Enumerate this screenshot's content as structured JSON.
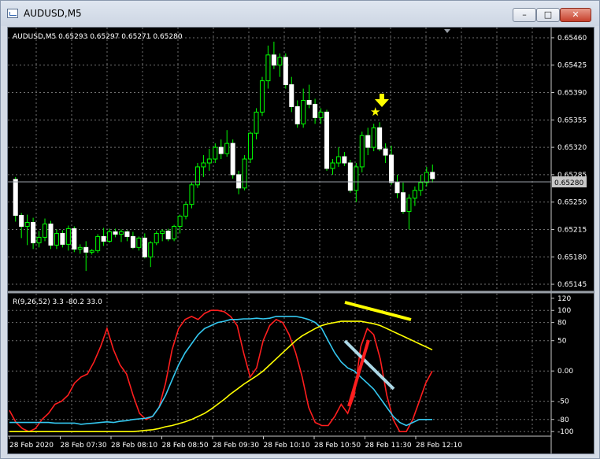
{
  "window": {
    "title": "AUDUSD,M5"
  },
  "price_panel": {
    "header": "AUDUSD,M5  0.65293 0.65297 0.65271 0.65280",
    "current_price": "0.65280"
  },
  "oscillator_panel": {
    "header": "R(9,26,52) 3.3 -80.2 33.0"
  },
  "colors": {
    "background": "#000000",
    "bullish": "#00ff00",
    "bearish": "#ffffff",
    "grid": "#707070",
    "red_line": "#ff1e1e",
    "yellow_line": "#ffff00",
    "cyan_line": "#34c8f0",
    "arrow": "#ffff00"
  },
  "chart_data": [
    {
      "type": "candlestick",
      "title": "AUDUSD,M5",
      "y_ticks": [
        "0.65460",
        "0.65425",
        "0.65390",
        "0.65355",
        "0.65320",
        "0.65285",
        "0.65250",
        "0.65215",
        "0.65180",
        "0.65145"
      ],
      "ylim": [
        0.65138,
        0.65468
      ],
      "last_price": 0.6528,
      "candles": [
        [
          0.65279,
          0.65282,
          0.65225,
          0.65233
        ],
        [
          0.65233,
          0.65236,
          0.65204,
          0.65219
        ],
        [
          0.65219,
          0.65234,
          0.65195,
          0.65224
        ],
        [
          0.65224,
          0.6523,
          0.6519,
          0.65198
        ],
        [
          0.65198,
          0.65213,
          0.65192,
          0.65205
        ],
        [
          0.65205,
          0.65229,
          0.652,
          0.65222
        ],
        [
          0.65222,
          0.65226,
          0.6519,
          0.65195
        ],
        [
          0.65195,
          0.65215,
          0.6519,
          0.6521
        ],
        [
          0.6521,
          0.65214,
          0.65192,
          0.65196
        ],
        [
          0.65196,
          0.6522,
          0.65188,
          0.65216
        ],
        [
          0.65216,
          0.65219,
          0.65186,
          0.6519
        ],
        [
          0.6519,
          0.65196,
          0.65184,
          0.65192
        ],
        [
          0.65192,
          0.652,
          0.65162,
          0.65186
        ],
        [
          0.65186,
          0.6519,
          0.65183,
          0.65188
        ],
        [
          0.65188,
          0.65209,
          0.65185,
          0.65206
        ],
        [
          0.65206,
          0.65217,
          0.65194,
          0.652
        ],
        [
          0.652,
          0.65216,
          0.65198,
          0.65212
        ],
        [
          0.65212,
          0.65216,
          0.65205,
          0.65209
        ],
        [
          0.65209,
          0.65215,
          0.65199,
          0.65212
        ],
        [
          0.65212,
          0.65214,
          0.652,
          0.65206
        ],
        [
          0.65206,
          0.65212,
          0.6519,
          0.65192
        ],
        [
          0.65192,
          0.65206,
          0.65188,
          0.65204
        ],
        [
          0.65204,
          0.6521,
          0.65178,
          0.6518
        ],
        [
          0.6518,
          0.652,
          0.65167,
          0.65198
        ],
        [
          0.65198,
          0.65213,
          0.65195,
          0.6521
        ],
        [
          0.6521,
          0.65215,
          0.652,
          0.65213
        ],
        [
          0.65213,
          0.65216,
          0.652,
          0.65203
        ],
        [
          0.65203,
          0.65221,
          0.652,
          0.65219
        ],
        [
          0.65219,
          0.65234,
          0.6521,
          0.65232
        ],
        [
          0.65232,
          0.6525,
          0.65228,
          0.65247
        ],
        [
          0.65247,
          0.65275,
          0.65242,
          0.65272
        ],
        [
          0.65272,
          0.653,
          0.65268,
          0.65295
        ],
        [
          0.65295,
          0.6531,
          0.65282,
          0.653
        ],
        [
          0.653,
          0.65318,
          0.6529,
          0.65305
        ],
        [
          0.65305,
          0.65325,
          0.653,
          0.6532
        ],
        [
          0.6532,
          0.6533,
          0.65305,
          0.65312
        ],
        [
          0.65312,
          0.65342,
          0.65308,
          0.65325
        ],
        [
          0.65325,
          0.6533,
          0.6528,
          0.65285
        ],
        [
          0.65285,
          0.6529,
          0.6526,
          0.65268
        ],
        [
          0.65268,
          0.6531,
          0.65265,
          0.65305
        ],
        [
          0.65305,
          0.6534,
          0.653,
          0.65338
        ],
        [
          0.65338,
          0.6537,
          0.6533,
          0.65365
        ],
        [
          0.65365,
          0.6541,
          0.6536,
          0.65405
        ],
        [
          0.65405,
          0.6545,
          0.65395,
          0.65438
        ],
        [
          0.65438,
          0.65455,
          0.6542,
          0.65425
        ],
        [
          0.65425,
          0.6544,
          0.6541,
          0.65435
        ],
        [
          0.65435,
          0.6544,
          0.65395,
          0.654
        ],
        [
          0.654,
          0.6541,
          0.65365,
          0.65372
        ],
        [
          0.65372,
          0.6538,
          0.65345,
          0.6535
        ],
        [
          0.6535,
          0.65395,
          0.65345,
          0.6538
        ],
        [
          0.6538,
          0.654,
          0.6537,
          0.65375
        ],
        [
          0.65375,
          0.65382,
          0.6535,
          0.65358
        ],
        [
          0.65358,
          0.6537,
          0.6535,
          0.65365
        ],
        [
          0.65365,
          0.65368,
          0.6529,
          0.65293
        ],
        [
          0.65293,
          0.65305,
          0.65285,
          0.653
        ],
        [
          0.653,
          0.6532,
          0.65295,
          0.65308
        ],
        [
          0.65308,
          0.65314,
          0.65296,
          0.653
        ],
        [
          0.653,
          0.65304,
          0.65262,
          0.65265
        ],
        [
          0.65265,
          0.653,
          0.6525,
          0.65295
        ],
        [
          0.65295,
          0.6534,
          0.65288,
          0.65335
        ],
        [
          0.65335,
          0.65345,
          0.6531,
          0.6532
        ],
        [
          0.6532,
          0.6535,
          0.65315,
          0.65345
        ],
        [
          0.65345,
          0.65352,
          0.65315,
          0.65318
        ],
        [
          0.65318,
          0.65325,
          0.653,
          0.6531
        ],
        [
          0.6531,
          0.65322,
          0.65272,
          0.65275
        ],
        [
          0.65275,
          0.65285,
          0.65255,
          0.65262
        ],
        [
          0.65262,
          0.65275,
          0.65235,
          0.65238
        ],
        [
          0.65238,
          0.6526,
          0.65215,
          0.65255
        ],
        [
          0.65255,
          0.6527,
          0.65245,
          0.65265
        ],
        [
          0.65265,
          0.65285,
          0.65258,
          0.65275
        ],
        [
          0.65275,
          0.65295,
          0.6527,
          0.65288
        ],
        [
          0.65288,
          0.65298,
          0.65275,
          0.6528
        ]
      ]
    },
    {
      "type": "line",
      "title": "R(9,26,52)",
      "y_ticks": [
        "120",
        "100",
        "80",
        "50",
        "0.00",
        "-50",
        "-80",
        "-100"
      ],
      "ylim": [
        -105,
        125
      ],
      "x_tick_labels": [
        "28 Feb 2020",
        "28 Feb 07:30",
        "28 Feb 08:10",
        "28 Feb 08:50",
        "28 Feb 09:30",
        "28 Feb 10:10",
        "28 Feb 10:50",
        "28 Feb 11:30",
        "28 Feb 12:10"
      ],
      "series": [
        {
          "color": "#ff1e1e",
          "values": [
            -65,
            -85,
            -95,
            -100,
            -95,
            -80,
            -70,
            -55,
            -50,
            -40,
            -20,
            -10,
            -5,
            15,
            40,
            70,
            35,
            10,
            -5,
            -40,
            -70,
            -80,
            -75,
            -60,
            -20,
            35,
            70,
            85,
            90,
            85,
            95,
            100,
            100,
            98,
            90,
            75,
            30,
            -10,
            5,
            50,
            75,
            85,
            80,
            60,
            30,
            -10,
            -60,
            -85,
            -90,
            -90,
            -75,
            -55,
            -70,
            -40,
            40,
            70,
            60,
            20,
            -40,
            -80,
            -100,
            -100,
            -80,
            -50,
            -20,
            0
          ]
        },
        {
          "color": "#34c8f0",
          "values": [
            -85,
            -85,
            -85,
            -85,
            -85,
            -85,
            -85,
            -86,
            -86,
            -86,
            -86,
            -88,
            -87,
            -86,
            -85,
            -84,
            -85,
            -83,
            -82,
            -80,
            -79,
            -78,
            -75,
            -60,
            -40,
            -15,
            10,
            30,
            45,
            60,
            70,
            75,
            80,
            82,
            85,
            85,
            86,
            86,
            87,
            86,
            87,
            90,
            90,
            90,
            90,
            88,
            85,
            80,
            70,
            50,
            30,
            15,
            5,
            0,
            -10,
            -20,
            -30,
            -45,
            -60,
            -75,
            -85,
            -90,
            -85,
            -80,
            -80,
            -80
          ]
        },
        {
          "color": "#ffff00",
          "values": [
            -100,
            -100,
            -100,
            -100,
            -100,
            -100,
            -100,
            -100,
            -100,
            -100,
            -100,
            -100,
            -100,
            -100,
            -100,
            -100,
            -100,
            -100,
            -100,
            -100,
            -99,
            -98,
            -97,
            -95,
            -92,
            -90,
            -87,
            -84,
            -80,
            -75,
            -70,
            -63,
            -55,
            -47,
            -38,
            -30,
            -22,
            -15,
            -8,
            0,
            10,
            20,
            30,
            40,
            50,
            58,
            64,
            70,
            75,
            78,
            80,
            82,
            82,
            82,
            82,
            80,
            78,
            75,
            70,
            65,
            60,
            55,
            50,
            45,
            40,
            35
          ]
        }
      ]
    }
  ]
}
